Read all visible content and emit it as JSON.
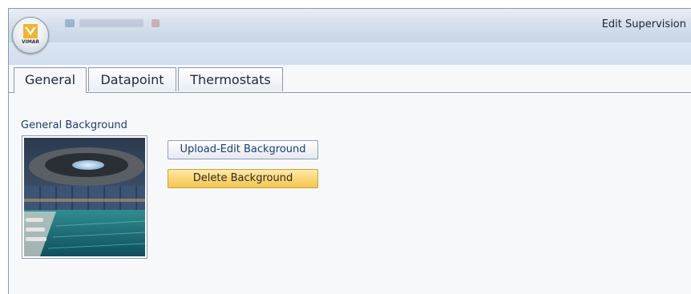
{
  "window": {
    "title": "Edit Supervision"
  },
  "app_button": {
    "logo_text": "VIMAR"
  },
  "tabs": [
    {
      "label": "General",
      "active": true
    },
    {
      "label": "Datapoint",
      "active": false
    },
    {
      "label": "Thermostats",
      "active": false
    }
  ],
  "general": {
    "section_label": "General Background",
    "upload_button": "Upload-Edit Background",
    "delete_button": "Delete Background"
  },
  "colors": {
    "accent_yellow": "#f6c649",
    "text_blue": "#1c3e6e"
  }
}
